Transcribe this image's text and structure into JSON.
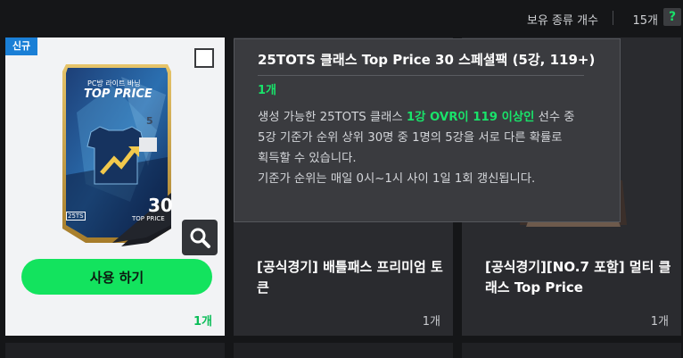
{
  "header": {
    "owned_types_label": "보유 종류 개수",
    "owned_types_count": "15개",
    "help_label": "?"
  },
  "colors": {
    "accent_green": "#13e35e",
    "badge_blue": "#1a7fd6",
    "background": "#151618"
  },
  "cards": [
    {
      "badge": "신규",
      "pack_top_text": "PC방 라이트 바닝",
      "pack_title": "TOP PRICE",
      "pack_rank": "5",
      "pack_number": "30",
      "pack_number_label": "TOP PRICE",
      "pack_season": "25TS",
      "use_button": "사용 하기",
      "count": "1개",
      "icons": [
        "checkbox-icon",
        "magnify-icon"
      ]
    },
    {
      "title": "[공식경기] 배틀패스 프리미엄 토큰",
      "count": "1개"
    },
    {
      "title": "[공식경기][NO.7 포함] 멀티 클래스 Top Price",
      "count": "1개"
    }
  ],
  "tooltip": {
    "title": "25TOTS 클래스 Top Price 30 스페셜팩 (5강, 119+)",
    "count": "1개",
    "body_line1_pre": "생성 가능한 25TOTS 클래스 ",
    "body_line1_hl": "1강 OVR이 119 이상인",
    "body_line1_post": " 선수 중",
    "body_line2": "5강 기준가 순위 상위 30명 중 1명의 5강을 서로 다른 확률로",
    "body_line3": "획득할 수 있습니다.",
    "body_line4": "기준가 순위는 매일 0시~1시 사이 1일 1회 갱신됩니다."
  }
}
